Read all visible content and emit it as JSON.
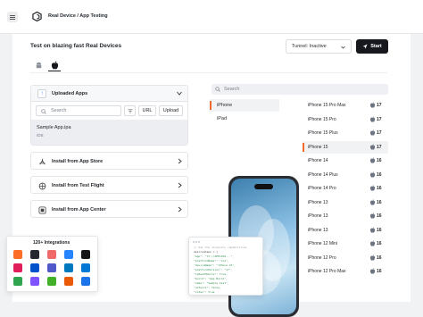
{
  "header": {
    "breadcrumb": "Real Device / App Testing"
  },
  "toolbar": {
    "heading": "Test on blazing fast Real Devices",
    "tunnel_value": "Tunnel: Inactive",
    "start_label": "Start"
  },
  "apps_panel": {
    "title": "Uploaded Apps",
    "search_placeholder": "Search",
    "url_label": "URL",
    "upload_label": "Upload",
    "app": {
      "name": "Sample App.ipa",
      "os": "iOS"
    }
  },
  "install_options": [
    {
      "label": "Install from App Store",
      "icon": "app-store-icon"
    },
    {
      "label": "Install from Test Flight",
      "icon": "test-flight-icon"
    },
    {
      "label": "Install from App Center",
      "icon": "app-center-icon"
    }
  ],
  "device_search_placeholder": "Search",
  "families": [
    "iPhone",
    "iPad"
  ],
  "active_family": "iPhone",
  "devices": [
    {
      "name": "iPhone 15 Pro Max",
      "version": "17"
    },
    {
      "name": "iPhone 15 Pro",
      "version": "17"
    },
    {
      "name": "iPhone 15 Plus",
      "version": "17"
    },
    {
      "name": "iPhone 15",
      "version": "17"
    },
    {
      "name": "iPhone 14",
      "version": "16"
    },
    {
      "name": "iPhone 14 Plus",
      "version": "16"
    },
    {
      "name": "iPhone 14 Pro",
      "version": "16"
    },
    {
      "name": "iPhone 13",
      "version": "16"
    },
    {
      "name": "iPhone 13",
      "version": "16"
    },
    {
      "name": "iPhone 13",
      "version": "16"
    },
    {
      "name": "iPhone 12 Mini",
      "version": "16"
    },
    {
      "name": "iPhone 12 Pro",
      "version": "16"
    },
    {
      "name": "iPhone 12 Pro Max",
      "version": "16"
    }
  ],
  "active_device": "iPhone 15",
  "integrations": {
    "title": "120+ Integrations",
    "icons": [
      {
        "name": "gitlab-icon",
        "color": "#fc6d26"
      },
      {
        "name": "github-icon",
        "color": "#24292f"
      },
      {
        "name": "asana-icon",
        "color": "#f06a6a"
      },
      {
        "name": "bitbucket-icon",
        "color": "#2684ff"
      },
      {
        "name": "circleci-icon",
        "color": "#161616"
      },
      {
        "name": "slack-icon",
        "color": "#e01e5a"
      },
      {
        "name": "jira-icon",
        "color": "#0052cc"
      },
      {
        "name": "teams-icon",
        "color": "#5059c9"
      },
      {
        "name": "trello-icon",
        "color": "#0079bf"
      },
      {
        "name": "azure-devops-icon",
        "color": "#0078d4"
      },
      {
        "name": "settings-plugin-icon",
        "color": "#2ea44f"
      },
      {
        "name": "kotlin-icon",
        "color": "#7f52ff"
      },
      {
        "name": "selenium-icon",
        "color": "#43b02a"
      },
      {
        "name": "webdriverio-icon",
        "color": "#ea5906"
      },
      {
        "name": "cypress-icon",
        "color": "#1a73e8"
      }
    ]
  },
  "code_snippet": [
    "// Set the necessary capabilities",
    "desiredCaps = {",
    "  \"app\": \"lt://APP1010...\",",
    "  \"platformName\": \"ios\",",
    "  \"deviceName\": \"iPhone 15\",",
    "  \"platformVersion\": \"17\",",
    "  \"isRealMobile\": true,",
    "  \"build\": \"App Build\",",
    "  \"name\": \"Sample test\",",
    "  \"network\": false,",
    "  \"video\": true",
    "}"
  ]
}
